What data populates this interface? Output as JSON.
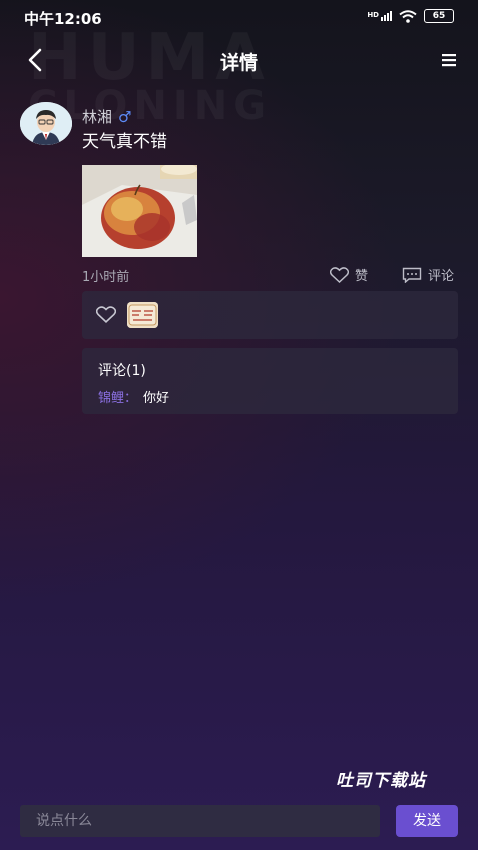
{
  "background_text": [
    "HUMA",
    "CLONING"
  ],
  "status_bar": {
    "time": "中午12:06",
    "network": "HD",
    "battery": "65"
  },
  "header": {
    "title": "详情"
  },
  "post": {
    "author": "林湘",
    "gender_symbol": "♂",
    "text": "天气真不错",
    "time": "1小时前",
    "like_label": "赞",
    "comment_label": "评论"
  },
  "comments": {
    "title": "评论(1)",
    "items": [
      {
        "author": "锦鲤：",
        "text": "你好"
      }
    ]
  },
  "watermark": "吐司下载站",
  "input": {
    "placeholder": "说点什么"
  },
  "send_label": "发送",
  "colors": {
    "accent": "#6a4fd0",
    "gender": "#5d8bf7",
    "comment_author": "#8a6fe0"
  }
}
